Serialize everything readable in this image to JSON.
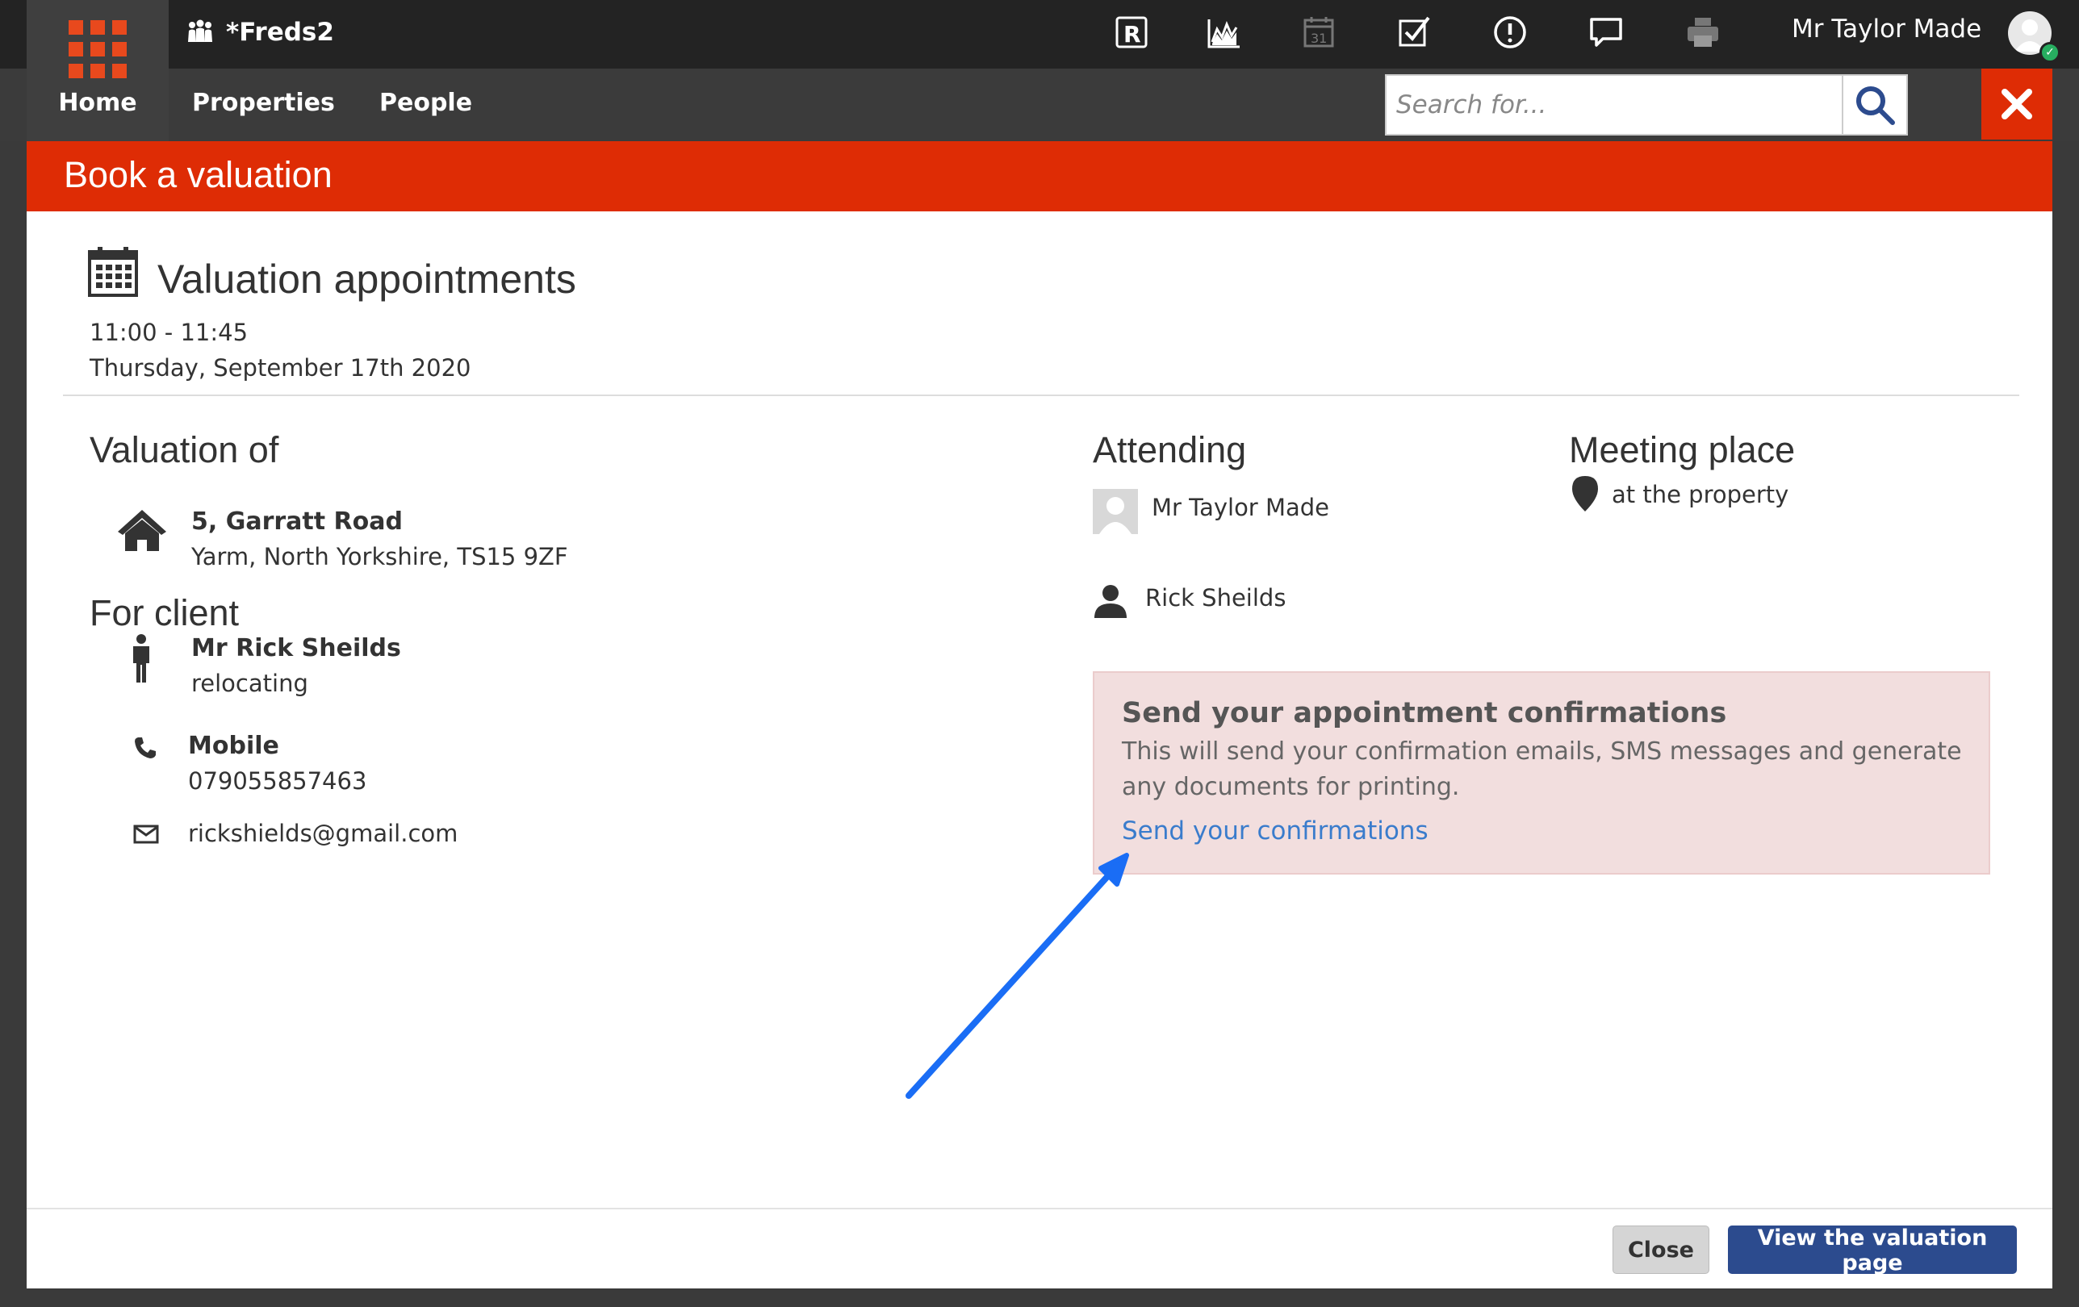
{
  "topbar": {
    "office_name": "*Freds2",
    "user_name": "Mr Taylor Made",
    "icons": [
      "r-icon",
      "chart-icon",
      "calendar-icon",
      "checkbox-icon",
      "alert-icon",
      "chat-icon",
      "printer-icon"
    ]
  },
  "nav": {
    "home": "Home",
    "properties": "Properties",
    "people": "People"
  },
  "search": {
    "placeholder": "Search for..."
  },
  "modal": {
    "title": "Book a valuation",
    "appointment": {
      "heading": "Valuation appointments",
      "time": "11:00 - 11:45",
      "date": "Thursday, September 17th 2020"
    },
    "valuation_of": {
      "heading": "Valuation of",
      "address_line1": "5, Garratt Road",
      "address_line2": "Yarm, North Yorkshire, TS15 9ZF"
    },
    "client": {
      "heading": "For client",
      "name": "Mr Rick Sheilds",
      "reason": "relocating",
      "phone_label": "Mobile",
      "phone": "079055857463",
      "email": "rickshields@gmail.com"
    },
    "attending": {
      "heading": "Attending",
      "people": [
        "Mr Taylor Made",
        "Rick Sheilds"
      ]
    },
    "meeting_place": {
      "heading": "Meeting place",
      "value": "at the property"
    },
    "confirmations": {
      "title": "Send your appointment confirmations",
      "description": "This will send your confirmation emails, SMS messages and generate any documents for printing.",
      "link": "Send your confirmations"
    },
    "footer": {
      "close": "Close",
      "view": "View the valuation page"
    }
  },
  "colors": {
    "accent_red": "#de2c05",
    "primary_blue": "#2c4b8e",
    "link_blue": "#3a7ccc",
    "arrow_blue": "#1a6df5"
  }
}
